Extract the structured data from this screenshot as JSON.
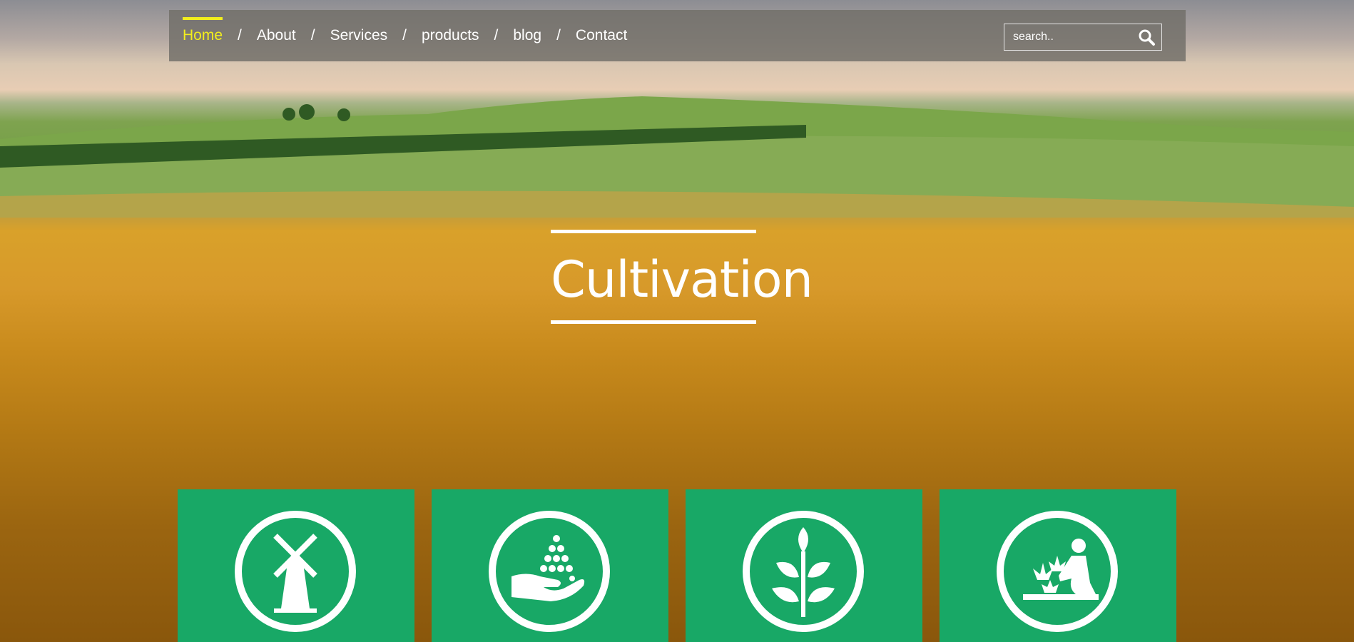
{
  "nav": {
    "items": [
      {
        "label": "Home",
        "active": true
      },
      {
        "label": "About"
      },
      {
        "label": "Services"
      },
      {
        "label": "products"
      },
      {
        "label": "blog"
      },
      {
        "label": "Contact"
      }
    ],
    "separator": "/"
  },
  "search": {
    "placeholder": "search..",
    "icon": "search-icon"
  },
  "hero": {
    "title": "Cultivation"
  },
  "cards": [
    {
      "icon": "windmill-icon"
    },
    {
      "icon": "hand-seeds-icon"
    },
    {
      "icon": "plant-icon"
    },
    {
      "icon": "gardener-icon"
    }
  ],
  "colors": {
    "active_nav": "#f2ee1d",
    "card_green": "#18a866",
    "nav_bg": "#706e68"
  }
}
